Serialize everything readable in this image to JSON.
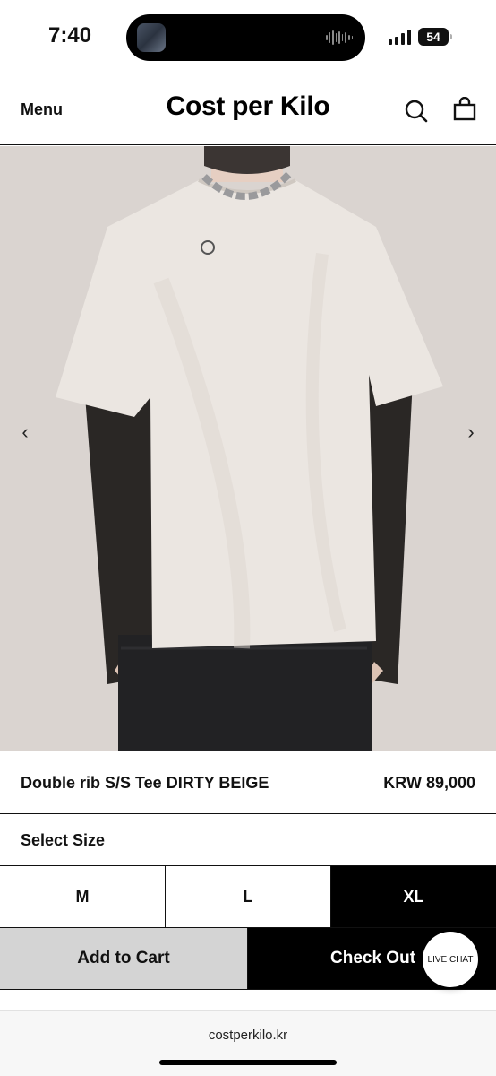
{
  "status_bar": {
    "time": "7:40",
    "battery_level": "54",
    "icons": [
      "signal-icon",
      "battery-icon"
    ]
  },
  "header": {
    "menu_label": "Menu",
    "site_title": "Cost per Kilo",
    "icons": [
      "search-icon",
      "shopping-bag-icon"
    ]
  },
  "carousel": {
    "prev_arrow": "‹",
    "next_arrow": "›",
    "icons": [
      "chevron-left-icon",
      "chevron-right-icon"
    ]
  },
  "product": {
    "name": "Double rib S/S Tee DIRTY BEIGE",
    "price": "KRW 89,000"
  },
  "size_selector": {
    "label": "Select Size",
    "options": [
      "M",
      "L",
      "XL"
    ],
    "selected": "XL"
  },
  "actions": {
    "add_to_cart": "Add to Cart",
    "check_out": "Check Out",
    "live_chat": "LIVE CHAT"
  },
  "browser": {
    "url": "costperkilo.kr"
  },
  "colors": {
    "primary": "#000000",
    "add_to_cart_bg": "#d4d4d4",
    "selected_size_bg": "#000000"
  }
}
